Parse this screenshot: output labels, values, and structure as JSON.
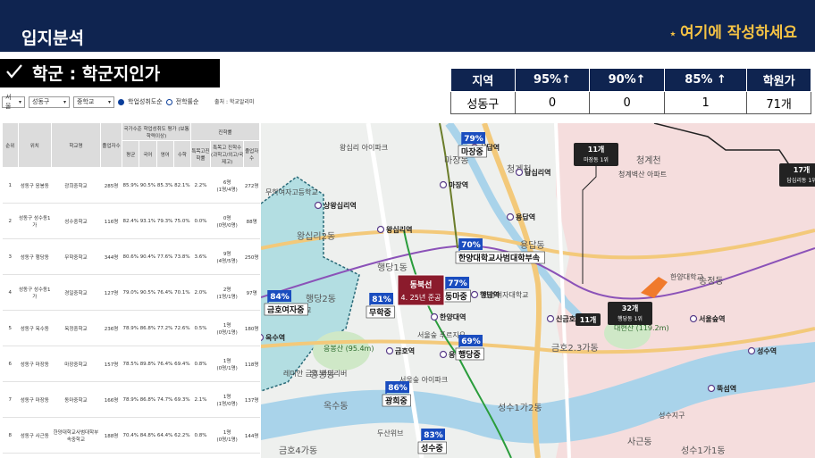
{
  "header": {
    "title": "입지분석",
    "note_star": "⋆",
    "note": "여기에 작성하세요"
  },
  "section": {
    "check_icon": "check-icon",
    "title": "학군 : 학군지인가"
  },
  "summary": {
    "headers": [
      "지역",
      "95%↑",
      "90%↑",
      "85% ↑",
      "학원가"
    ],
    "row": [
      "성동구",
      "0",
      "0",
      "1",
      "71개"
    ]
  },
  "filters": {
    "city": "서울",
    "district": "성동구",
    "level": "중학교",
    "option1": "학업성취도순",
    "option2": "전학률순",
    "source": "출처 : 학교알리미"
  },
  "table": {
    "col_headers": [
      "순위",
      "위치",
      "학교명",
      "졸업자수",
      "국가수준 학업성취도 평가 (보통학력이상)",
      "진학률"
    ],
    "sub_headers": [
      "평균",
      "국어",
      "영어",
      "수학",
      "특목고진학률",
      "특목고 진학수(과학고/외고/국제고)",
      "졸업자수"
    ],
    "rows": [
      [
        "1",
        "성동구 응봉동",
        "광희중학교",
        "285명",
        "85.9%",
        "90.5%",
        "85.3%",
        "82.1%",
        "2.2%",
        "6명",
        "(1명/4명)",
        "272명"
      ],
      [
        "2",
        "성동구 성수동1가",
        "성수중학교",
        "116명",
        "82.4%",
        "93.1%",
        "79.3%",
        "75.0%",
        "0.0%",
        "0명",
        "(0명/0명)",
        "88명"
      ],
      [
        "3",
        "성동구 행당동",
        "무학중학교",
        "344명",
        "80.6%",
        "90.4%",
        "77.6%",
        "73.8%",
        "3.6%",
        "9명",
        "(4명/5명)",
        "250명"
      ],
      [
        "4",
        "성동구 성수동1가",
        "경일중학교",
        "127명",
        "79.0%",
        "90.5%",
        "76.4%",
        "70.1%",
        "2.0%",
        "2명",
        "(1명/1명)",
        "97명"
      ],
      [
        "5",
        "성동구 옥수동",
        "옥정중학교",
        "236명",
        "78.9%",
        "86.8%",
        "77.2%",
        "72.6%",
        "0.5%",
        "1명",
        "(0명/1명)",
        "180명"
      ],
      [
        "6",
        "성동구 마장동",
        "마장중학교",
        "157명",
        "78.5%",
        "89.8%",
        "76.4%",
        "69.4%",
        "0.8%",
        "1명",
        "(0명/1명)",
        "118명"
      ],
      [
        "7",
        "성동구 마장동",
        "동마중학교",
        "166명",
        "78.9%",
        "86.8%",
        "74.7%",
        "69.3%",
        "2.1%",
        "1명",
        "(1명/0명)",
        "137명"
      ],
      [
        "8",
        "성동구 사근동",
        "한양대학교사범대학부속중학교",
        "188명",
        "70.4%",
        "84.8%",
        "64.4%",
        "62.2%",
        "0.8%",
        "1명",
        "(0명/1명)",
        "144명"
      ]
    ]
  },
  "map": {
    "districts": [
      "왕십리2동",
      "마장동",
      "행당1동",
      "행당2동",
      "응봉동",
      "금호2.3가동",
      "금호4가동",
      "옥수동",
      "성수1가2동",
      "성수1가1동",
      "사근동",
      "송정동",
      "용답동",
      "청계천",
      "청계천"
    ],
    "parks": [
      "응봉산 (95.4m)",
      "대현산 (119.2m)"
    ],
    "places": [
      "왕십리 아이파크",
      "청계벽산 아파트",
      "한양대학교",
      "한양여자대학교",
      "무학여자고등학교",
      "금호여자중학교",
      "레미안 금호 하이리버",
      "서울숲 아이파크",
      "서울숲 푸르지오",
      "성수지구",
      "두산위브"
    ],
    "stations": [
      "왕십리역",
      "신답역",
      "상왕십리역",
      "답십리역",
      "용답역",
      "마장역",
      "한양대역",
      "행당역",
      "신금호역",
      "옥수역",
      "금호역",
      "서울숲역",
      "뚝섬역",
      "성수역",
      "응봉역"
    ],
    "markers": [
      {
        "pct": "79%",
        "name": "마장중"
      },
      {
        "pct": "70%",
        "name": "한양대학교사범대학부속"
      },
      {
        "pct": "77%",
        "name": "동마중"
      },
      {
        "pct": "81%",
        "name": "무학중"
      },
      {
        "pct": "84%",
        "name": "금호여자중"
      },
      {
        "pct": "69%",
        "name": "행당중"
      },
      {
        "pct": "86%",
        "name": "광희중"
      },
      {
        "pct": "83%",
        "name": "성수중"
      }
    ],
    "callout": {
      "line1": "동북선",
      "line2": "4. 25년 준공"
    },
    "academies": [
      {
        "count": "11개",
        "sub": "마장동 1위"
      },
      {
        "count": "17개",
        "sub": "답십리동 1위"
      },
      {
        "count": "32개",
        "sub": "행당동 1위"
      },
      {
        "count": "11개",
        "sub": ""
      }
    ]
  }
}
